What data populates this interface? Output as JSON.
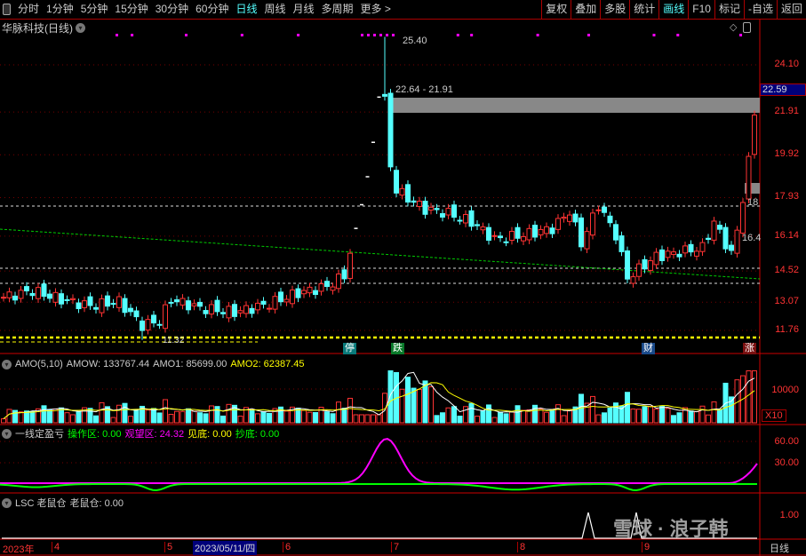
{
  "toolbar": {
    "periods": [
      "分时",
      "1分钟",
      "5分钟",
      "15分钟",
      "30分钟",
      "60分钟",
      "日线",
      "周线",
      "月线",
      "多周期",
      "更多 >"
    ],
    "active_period": "日线",
    "right": [
      "复权",
      "叠加",
      "多股",
      "统计",
      "画线",
      "F10",
      "标记",
      "-自选",
      "返回"
    ],
    "active_right": "画线"
  },
  "title": "华脉科技(日线)",
  "price_axis": [
    "24.10",
    "21.91",
    "19.92",
    "17.93",
    "16.14",
    "14.52",
    "13.07",
    "11.76"
  ],
  "current_price": "22.59",
  "annotations": {
    "high": "25.40",
    "gap": "22.64 - 21.91",
    "low": "11.32",
    "label_18": "18",
    "label_16": "16.4"
  },
  "tags": [
    {
      "text": "停",
      "color": "#0a7a7a"
    },
    {
      "text": "跌",
      "color": "#0a7a2a"
    },
    {
      "text": "财",
      "color": "#1a4a8a"
    },
    {
      "text": "涨",
      "color": "#7a1010"
    }
  ],
  "amo": {
    "name": "AMO(5,10)",
    "amow": "AMOW: 133767.44",
    "amo1": "AMO1: 85699.00",
    "amo2": "AMO2: 62387.45",
    "axis": "10000",
    "multiplier": "X10"
  },
  "ind": {
    "name": "一线定盈亏",
    "a": "操作区: 0.00",
    "b": "观望区: 24.32",
    "c": "见底: 0.00",
    "d": "抄底: 0.00",
    "axis": [
      "60.00",
      "30.00"
    ]
  },
  "lsc": {
    "name": "LSC 老鼠仓",
    "value": "老鼠仓: 0.00",
    "axis": "1.00"
  },
  "dates": {
    "year": "2023年",
    "months": [
      "4",
      "5",
      "6",
      "7",
      "8",
      "9"
    ],
    "cursor": "2023/05/11/四",
    "period": "日线"
  },
  "watermark": "雪球 · 浪子韩",
  "chart_data": {
    "type": "candlestick",
    "note": "approximate close by candle index",
    "waypoints": [
      [
        0,
        13.3
      ],
      [
        5,
        13.6
      ],
      [
        10,
        13.2
      ],
      [
        15,
        12.9
      ],
      [
        20,
        13.1
      ],
      [
        24,
        12.0
      ],
      [
        27,
        12.2
      ],
      [
        29,
        13.2
      ],
      [
        34,
        12.8
      ],
      [
        40,
        12.6
      ],
      [
        46,
        13.0
      ],
      [
        51,
        13.5
      ],
      [
        56,
        13.8
      ],
      [
        59,
        14.3
      ],
      [
        61,
        16.5
      ],
      [
        62,
        17.6
      ],
      [
        63,
        18.9
      ],
      [
        64,
        20.5
      ],
      [
        65,
        22.6
      ],
      [
        66,
        22.64
      ],
      [
        67,
        19.4
      ],
      [
        68,
        18.3
      ],
      [
        70,
        17.9
      ],
      [
        73,
        17.4
      ],
      [
        77,
        17.2
      ],
      [
        81,
        16.8
      ],
      [
        85,
        16.0
      ],
      [
        90,
        16.2
      ],
      [
        95,
        16.5
      ],
      [
        98,
        17.3
      ],
      [
        100,
        15.8
      ],
      [
        103,
        17.6
      ],
      [
        106,
        16.2
      ],
      [
        108,
        14.2
      ],
      [
        110,
        14.6
      ],
      [
        113,
        15.2
      ],
      [
        117,
        15.4
      ],
      [
        121,
        15.6
      ],
      [
        123,
        16.8
      ],
      [
        126,
        15.3
      ],
      [
        127,
        16.4
      ],
      [
        128,
        17.9
      ],
      [
        129,
        19.6
      ],
      [
        130,
        21.9
      ]
    ],
    "amo_axis": 10000,
    "ind_axis": [
      60,
      30
    ]
  }
}
